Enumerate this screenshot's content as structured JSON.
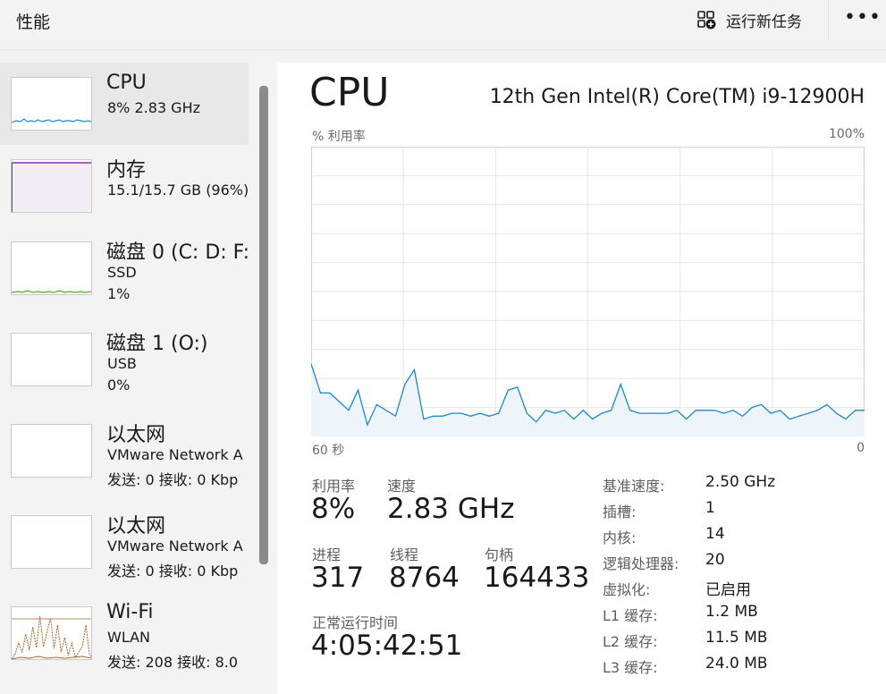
{
  "header": {
    "title": "性能",
    "new_task_label": "运行新任务",
    "more_label": "•••"
  },
  "sidebar": {
    "items": [
      {
        "name": "CPU",
        "sub1": "8%  2.83 GHz",
        "sub2": "",
        "color": "#1c88c7"
      },
      {
        "name": "内存",
        "sub1": "15.1/15.7 GB (96%)",
        "sub2": "",
        "color": "#8e2cae"
      },
      {
        "name": "磁盘 0 (C: D: F:",
        "sub1": "SSD",
        "sub2": "1%",
        "color": "#4cab36"
      },
      {
        "name": "磁盘 1 (O:)",
        "sub1": "USB",
        "sub2": "0%",
        "color": "#4cab36"
      },
      {
        "name": "以太网",
        "sub1": "VMware Network A",
        "sub2": "发送: 0 接收: 0 Kbp",
        "color": "#a7652a"
      },
      {
        "name": "以太网",
        "sub1": "VMware Network A",
        "sub2": "发送: 0 接收: 0 Kbp",
        "color": "#a7652a"
      },
      {
        "name": "Wi-Fi",
        "sub1": "WLAN",
        "sub2": "发送: 208 接收: 8.0",
        "color": "#a7652a"
      }
    ]
  },
  "main": {
    "title": "CPU",
    "cpu_model": "12th Gen Intel(R) Core(TM) i9-12900H",
    "graph": {
      "y_label": "% 利用率",
      "y_max_label": "100%",
      "x_left_label": "60 秒",
      "x_right_label": "0",
      "line_color": "#1c88c7",
      "fill_color": "#eef5fa",
      "grid_color": "#e6e6e6",
      "values": [
        25,
        15,
        15,
        12,
        9,
        16,
        4,
        11,
        9,
        7,
        18,
        23,
        6,
        7,
        7,
        8,
        8,
        7,
        8,
        7,
        8,
        16,
        17,
        8,
        5,
        9,
        8,
        9,
        6,
        9,
        6,
        8,
        9,
        18,
        9,
        8,
        8,
        8,
        8,
        9,
        6,
        9,
        9,
        9,
        8,
        9,
        7,
        10,
        11,
        8,
        9,
        6,
        7,
        8,
        9,
        11,
        8,
        6,
        9,
        9
      ]
    },
    "stats": {
      "utilization": {
        "label": "利用率",
        "value": "8%"
      },
      "speed": {
        "label": "速度",
        "value": "2.83 GHz"
      },
      "processes": {
        "label": "进程",
        "value": "317"
      },
      "threads": {
        "label": "线程",
        "value": "8764"
      },
      "handles": {
        "label": "句柄",
        "value": "164433"
      },
      "uptime": {
        "label": "正常运行时间",
        "value": "4:05:42:51"
      }
    },
    "specs": [
      {
        "label": "基准速度:",
        "value": "2.50 GHz"
      },
      {
        "label": "插槽:",
        "value": "1"
      },
      {
        "label": "内核:",
        "value": "14"
      },
      {
        "label": "逻辑处理器:",
        "value": "20"
      },
      {
        "label": "虚拟化:",
        "value": "已启用"
      },
      {
        "label": "L1 缓存:",
        "value": "1.2 MB"
      },
      {
        "label": "L2 缓存:",
        "value": "11.5 MB"
      },
      {
        "label": "L3 缓存:",
        "value": "24.0 MB"
      }
    ]
  }
}
